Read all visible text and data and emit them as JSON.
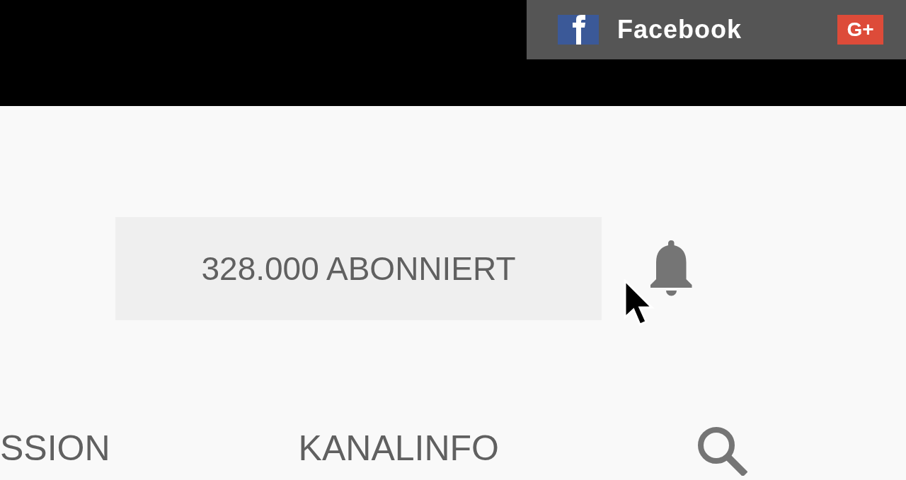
{
  "share_bar": {
    "items": [
      {
        "kind": "facebook",
        "label": "Facebook"
      },
      {
        "kind": "googleplus",
        "label": "G+"
      }
    ]
  },
  "subscribe_button": {
    "label": "328.000 ABONNIERT"
  },
  "tabs": [
    {
      "label": "SSION",
      "selected": false
    },
    {
      "label": "KANALINFO",
      "selected": false
    }
  ]
}
